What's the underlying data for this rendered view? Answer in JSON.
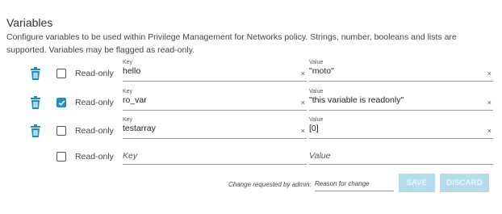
{
  "section": {
    "title": "Variables",
    "description": "Configure variables to be used within Privilege Management for Networks policy. Strings, number, booleans and lists are supported. Variables may be flagged as read-only."
  },
  "variables": [
    {
      "read_only_label": "Read-only",
      "read_only": false,
      "key_label": "Key",
      "key": "hello",
      "value_label": "Value",
      "value": "\"moto\"",
      "clear_glyph": "×"
    },
    {
      "read_only_label": "Read-only",
      "read_only": true,
      "key_label": "Key",
      "key": "ro_var",
      "value_label": "Value",
      "value": "\"this variable is readonly\"",
      "clear_glyph": "×"
    },
    {
      "read_only_label": "Read-only",
      "read_only": false,
      "key_label": "Key",
      "key": "testarray",
      "value_label": "Value",
      "value": "[0]",
      "clear_glyph": "×"
    }
  ],
  "new_variable": {
    "read_only_label": "Read-only",
    "key_placeholder": "Key",
    "value_placeholder": "Value"
  },
  "footer": {
    "change_label": "Change requested by admin:",
    "reason_placeholder": "Reason for change",
    "save_label": "SAVE",
    "discard_label": "DISCARD"
  },
  "colors": {
    "accent": "#1e8fc5",
    "button_disabled": "#b3dcec"
  },
  "icons": {
    "delete": "trash-icon",
    "checked": "checkmark-icon",
    "clear": "clear-icon"
  }
}
